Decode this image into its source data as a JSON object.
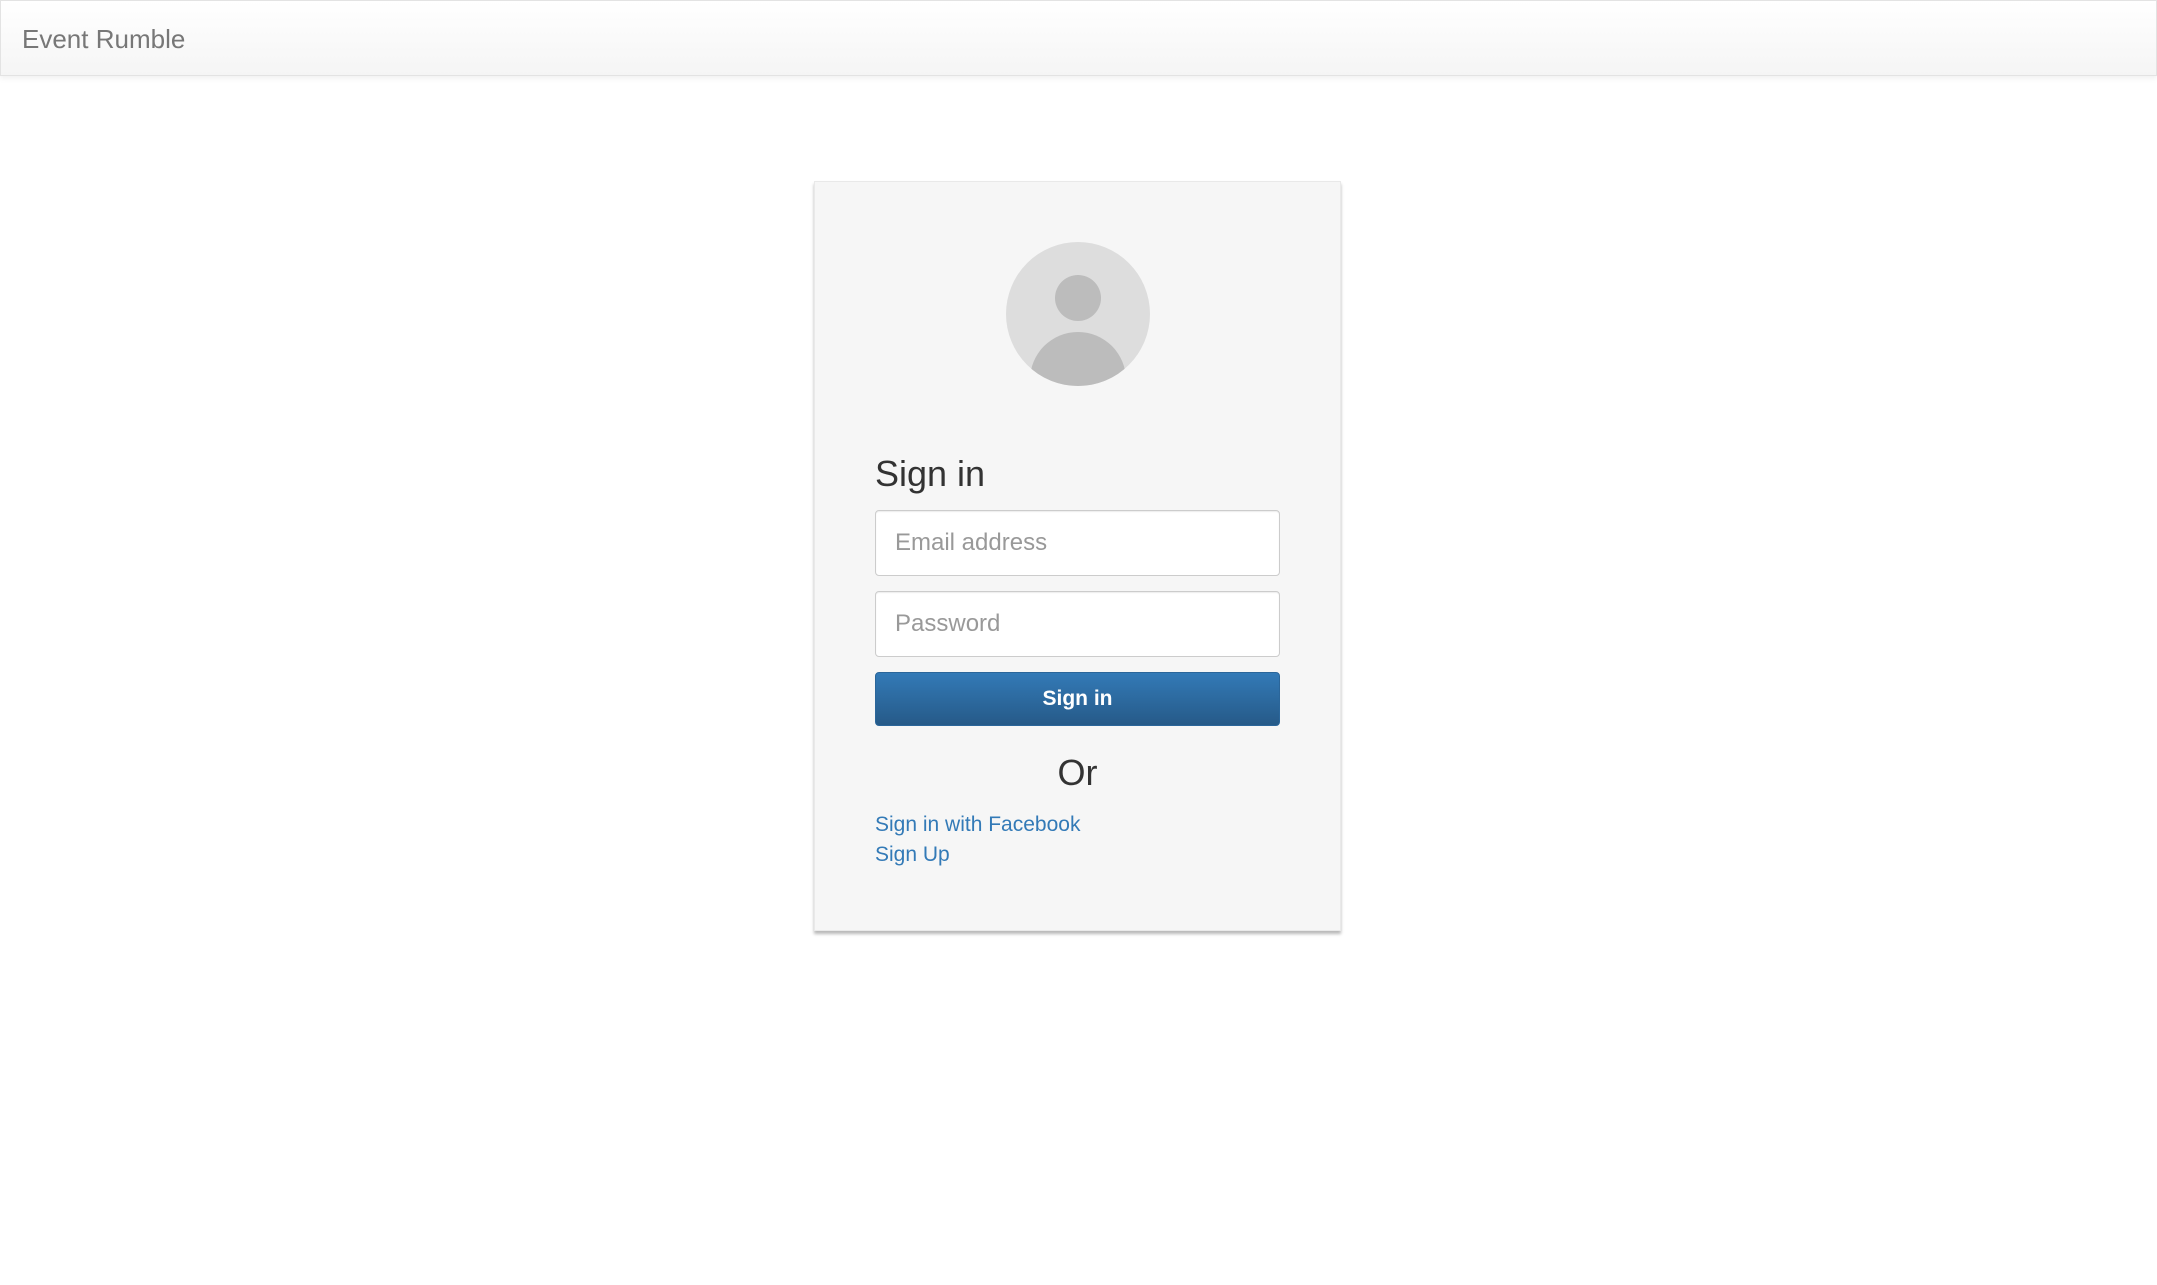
{
  "navbar": {
    "brand": "Event Rumble"
  },
  "signin": {
    "title": "Sign in",
    "email_placeholder": "Email address",
    "email_value": "",
    "password_placeholder": "Password",
    "password_value": "",
    "submit_label": "Sign in",
    "divider_text": "Or",
    "facebook_link": "Sign in with Facebook",
    "signup_link": "Sign Up"
  },
  "icons": {
    "avatar": "user-avatar-placeholder-icon"
  },
  "colors": {
    "primary": "#337ab7",
    "primary_dark": "#265a88",
    "link": "#337ab7",
    "card_bg": "#f6f6f6",
    "avatar_bg": "#dddddd",
    "avatar_fg": "#bcbcbc"
  }
}
